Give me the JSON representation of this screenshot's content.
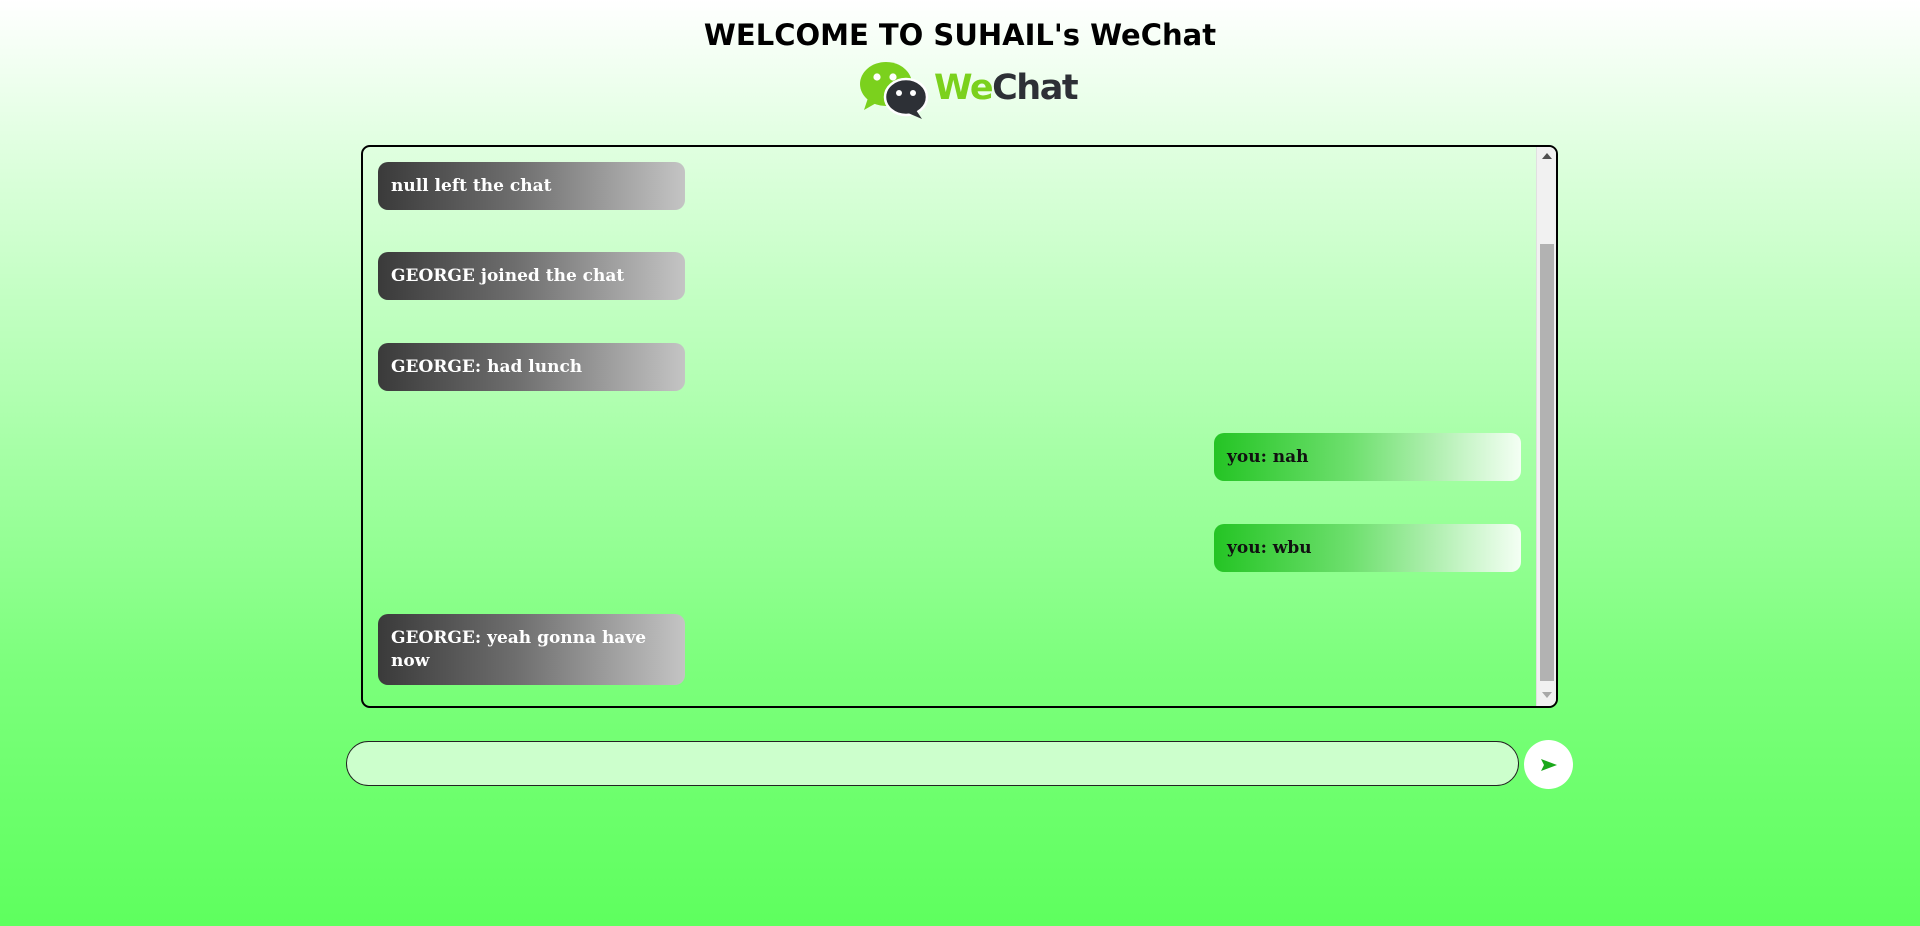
{
  "header": {
    "title": "WELCOME TO SUHAIL's WeChat",
    "logo_we": "We",
    "logo_chat": "Chat",
    "logo_icon": "wechat-bubbles-icon"
  },
  "messages": [
    {
      "side": "left",
      "text": "null left the chat"
    },
    {
      "side": "left",
      "text": "GEORGE joined the chat"
    },
    {
      "side": "left",
      "text": "GEORGE: had lunch"
    },
    {
      "side": "right",
      "text": "you: nah"
    },
    {
      "side": "right",
      "text": "you: wbu"
    },
    {
      "side": "left",
      "text": "GEORGE: yeah gonna have now"
    }
  ],
  "composer": {
    "input_value": "",
    "input_placeholder": "",
    "send_icon": "send-arrow-icon"
  },
  "colors": {
    "brand_green": "#7bd11d",
    "brand_dark": "#2d3036",
    "send_arrow": "#1aa81a"
  }
}
